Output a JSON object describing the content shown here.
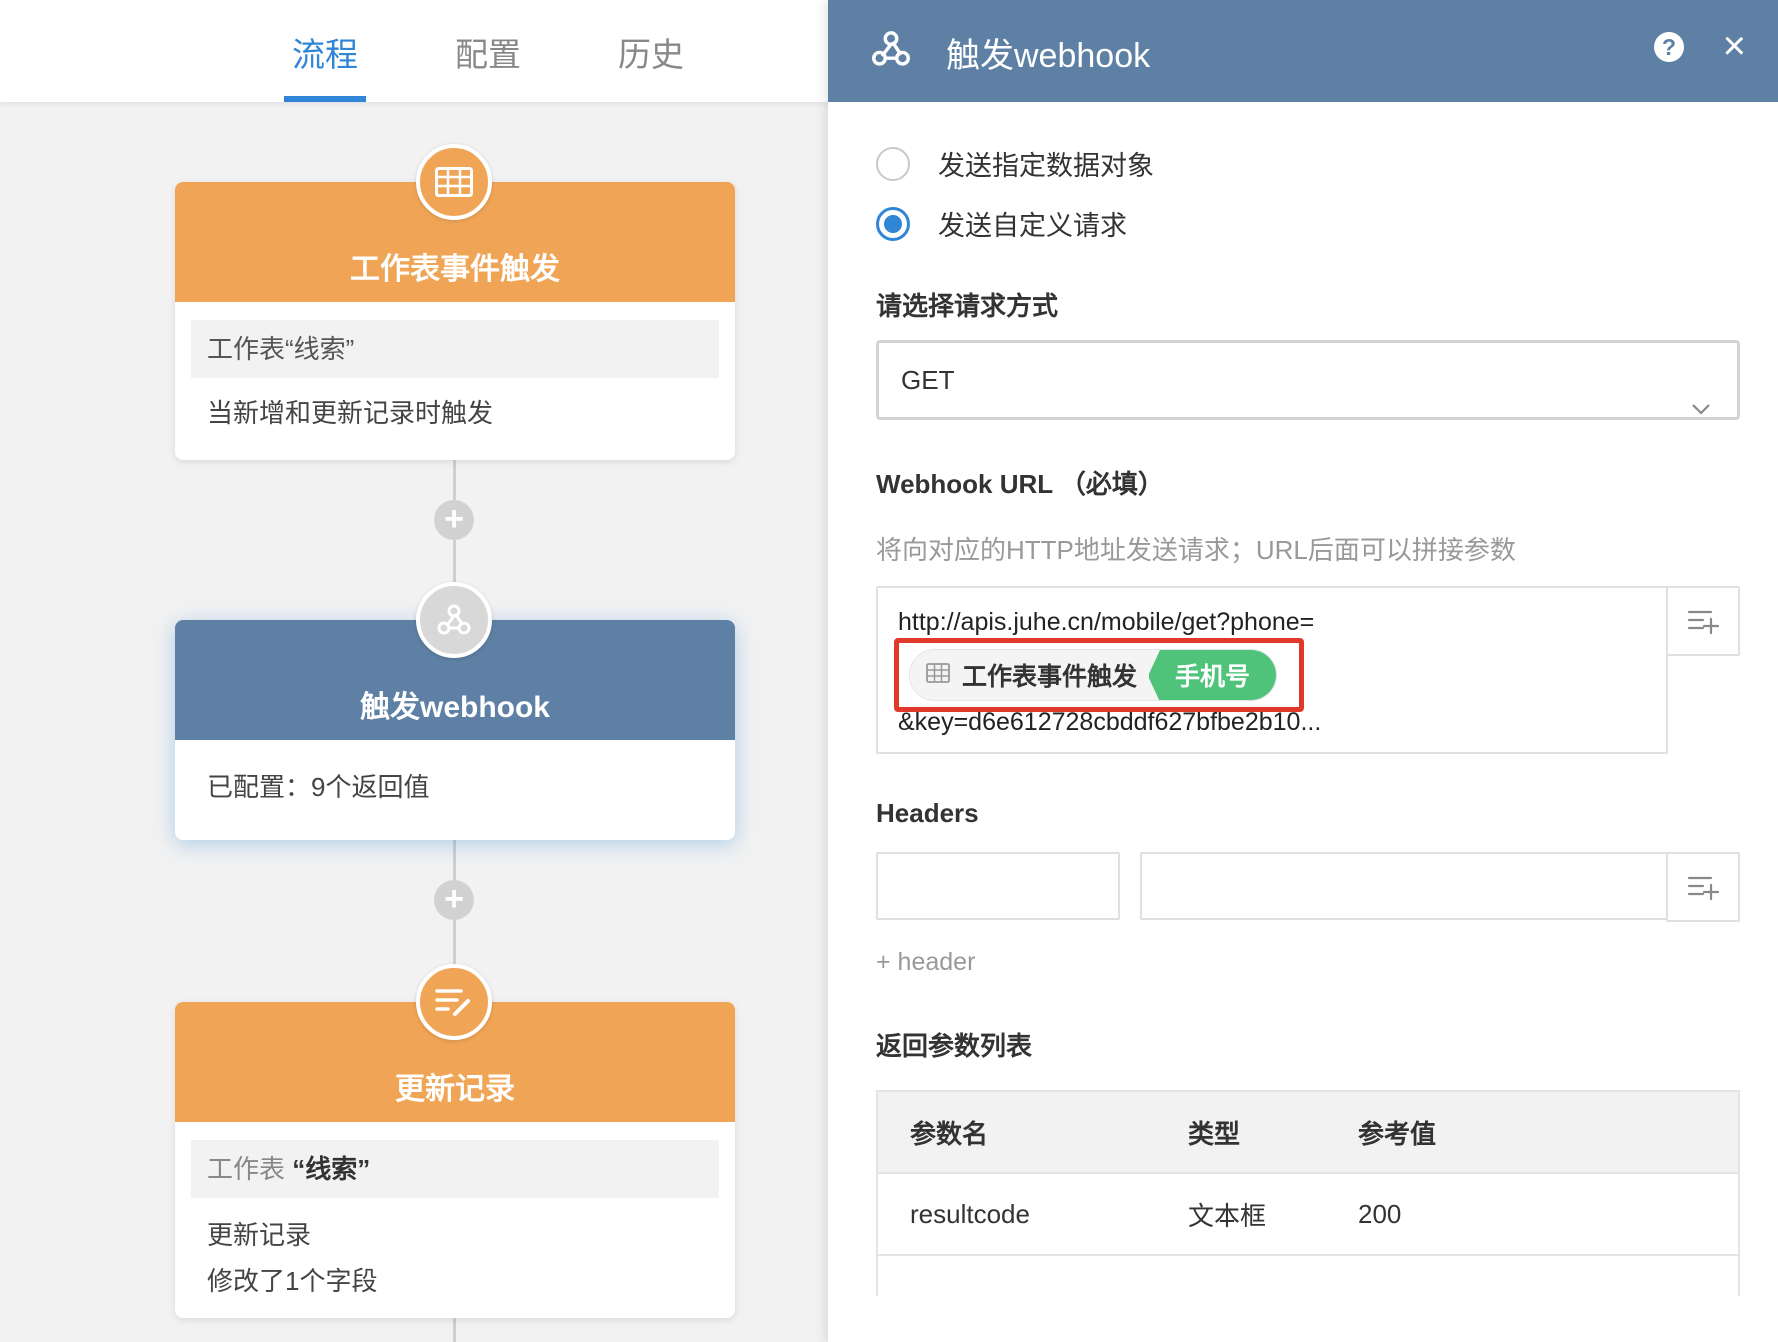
{
  "tabs": {
    "flow": "流程",
    "config": "配置",
    "history": "历史"
  },
  "cards": {
    "trigger": {
      "title": "工作表事件触发",
      "sheet": "工作表“线索”",
      "desc": "当新增和更新记录时触发"
    },
    "webhook": {
      "title": "触发webhook",
      "desc": "已配置：9个返回值"
    },
    "update": {
      "title": "更新记录",
      "sheet_prefix": "工作表",
      "sheet_name": "“线索”",
      "line1": "更新记录",
      "line2": "修改了1个字段"
    }
  },
  "panel": {
    "title": "触发webhook",
    "help": "?",
    "close": "×",
    "radio_specific": "发送指定数据对象",
    "radio_custom": "发送自定义请求",
    "selected_radio": "custom",
    "method_label": "请选择请求方式",
    "method_value": "GET",
    "url_label": "Webhook URL （必填）",
    "url_hint": "将向对应的HTTP地址发送请求；URL后面可以拼接参数",
    "url_line1": "http://apis.juhe.cn/mobile/get?phone=",
    "url_tag_source": "工作表事件触发",
    "url_tag_field": "手机号",
    "url_line3": "&key=d6e612728cbddf627bfbe2b10...",
    "headers_label": "Headers",
    "add_header": "+ header",
    "return_label": "返回参数列表",
    "table": {
      "headers": [
        "参数名",
        "类型",
        "参考值"
      ],
      "rows": [
        [
          "resultcode",
          "文本框",
          "200"
        ]
      ]
    }
  },
  "colors": {
    "accent": "#2f86d6",
    "orange": "#f0a556",
    "steel_blue": "#5d80a4",
    "green": "#4fc37a",
    "highlight_red": "#e0392b"
  }
}
